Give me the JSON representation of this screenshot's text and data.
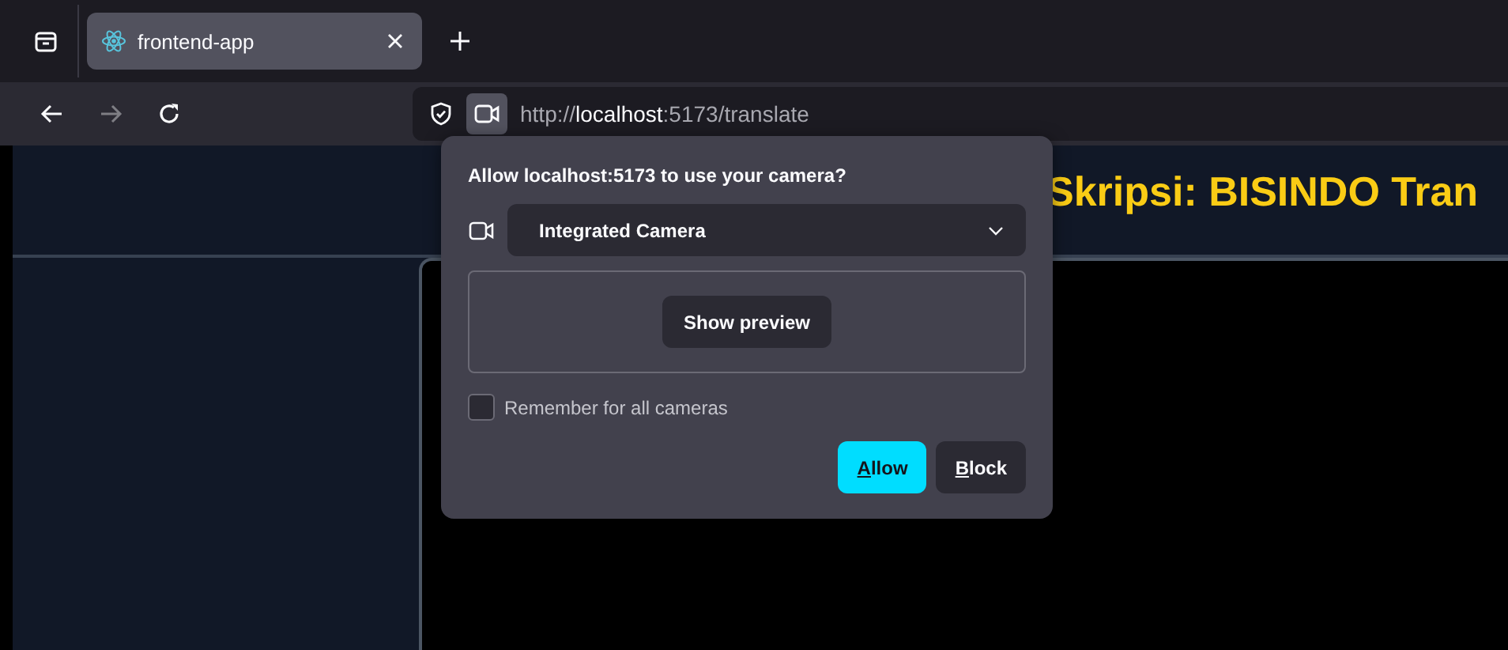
{
  "tabs": [
    {
      "title": "frontend-app",
      "selected": true
    }
  ],
  "toolbar": {
    "back_enabled": true,
    "forward_enabled": false,
    "url": "http://**localhost**:5173/translate"
  },
  "page": {
    "title": "Skripsi: BISINDO Tran"
  },
  "permission_popup": {
    "question": "Allow localhost:5173 to use your camera?",
    "device": "Integrated Camera",
    "preview_button": "Show preview",
    "remember": {
      "label": "Remember for all cameras",
      "checked": false
    },
    "buttons": [
      {
        "label": "Allow",
        "kind": "primary"
      },
      {
        "label": "Block",
        "kind": "secondary"
      }
    ]
  }
}
